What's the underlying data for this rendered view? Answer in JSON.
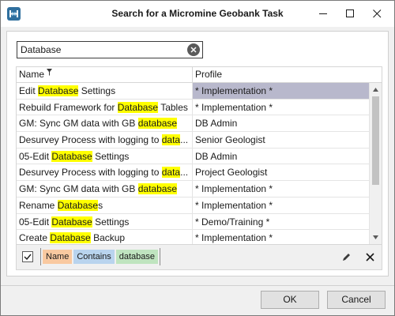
{
  "window": {
    "title": "Search for a Micromine Geobank Task",
    "icons": {
      "app": "micromine-app-icon",
      "minimize": "minimize-icon",
      "maximize": "maximize-icon",
      "close": "close-icon"
    }
  },
  "search": {
    "value": "Database",
    "clear_icon": "clear-circle-icon"
  },
  "grid": {
    "columns": [
      {
        "label": "Name",
        "filter_icon": "filter-icon"
      },
      {
        "label": "Profile"
      }
    ],
    "rows": [
      {
        "name_pre": "Edit ",
        "name_match": "Database",
        "name_post": " Settings",
        "profile": "* Implementation *",
        "selected": true
      },
      {
        "name_pre": "Rebuild Framework for ",
        "name_match": "Database",
        "name_post": " Tables",
        "profile": "* Implementation *"
      },
      {
        "name_pre": "GM: Sync GM data with GB ",
        "name_match": "database",
        "name_post": "",
        "profile": "DB Admin"
      },
      {
        "name_pre": "Desurvey Process with logging to ",
        "name_match": "data",
        "name_post": "...",
        "profile": "Senior Geologist"
      },
      {
        "name_pre": "05-Edit ",
        "name_match": "Database",
        "name_post": " Settings",
        "profile": "DB Admin"
      },
      {
        "name_pre": "Desurvey Process with logging to ",
        "name_match": "data",
        "name_post": "...",
        "profile": "Project Geologist"
      },
      {
        "name_pre": "GM: Sync GM data with GB ",
        "name_match": "database",
        "name_post": "",
        "profile": "* Implementation *"
      },
      {
        "name_pre": "Rename ",
        "name_match": "Database",
        "name_post": "s",
        "profile": "* Implementation *"
      },
      {
        "name_pre": "05-Edit ",
        "name_match": "Database",
        "name_post": " Settings",
        "profile": "* Demo/Training *"
      },
      {
        "name_pre": "Create ",
        "name_match": "Database",
        "name_post": " Backup",
        "profile": "* Implementation *"
      }
    ],
    "highlight_color": "#ffff00",
    "selected_color": "#b8b8cc"
  },
  "filter_bar": {
    "checked": true,
    "field": "Name",
    "operator": "Contains",
    "value": "database",
    "edit_icon": "pencil-icon",
    "clear_icon": "close-icon"
  },
  "buttons": {
    "ok": "OK",
    "cancel": "Cancel"
  }
}
